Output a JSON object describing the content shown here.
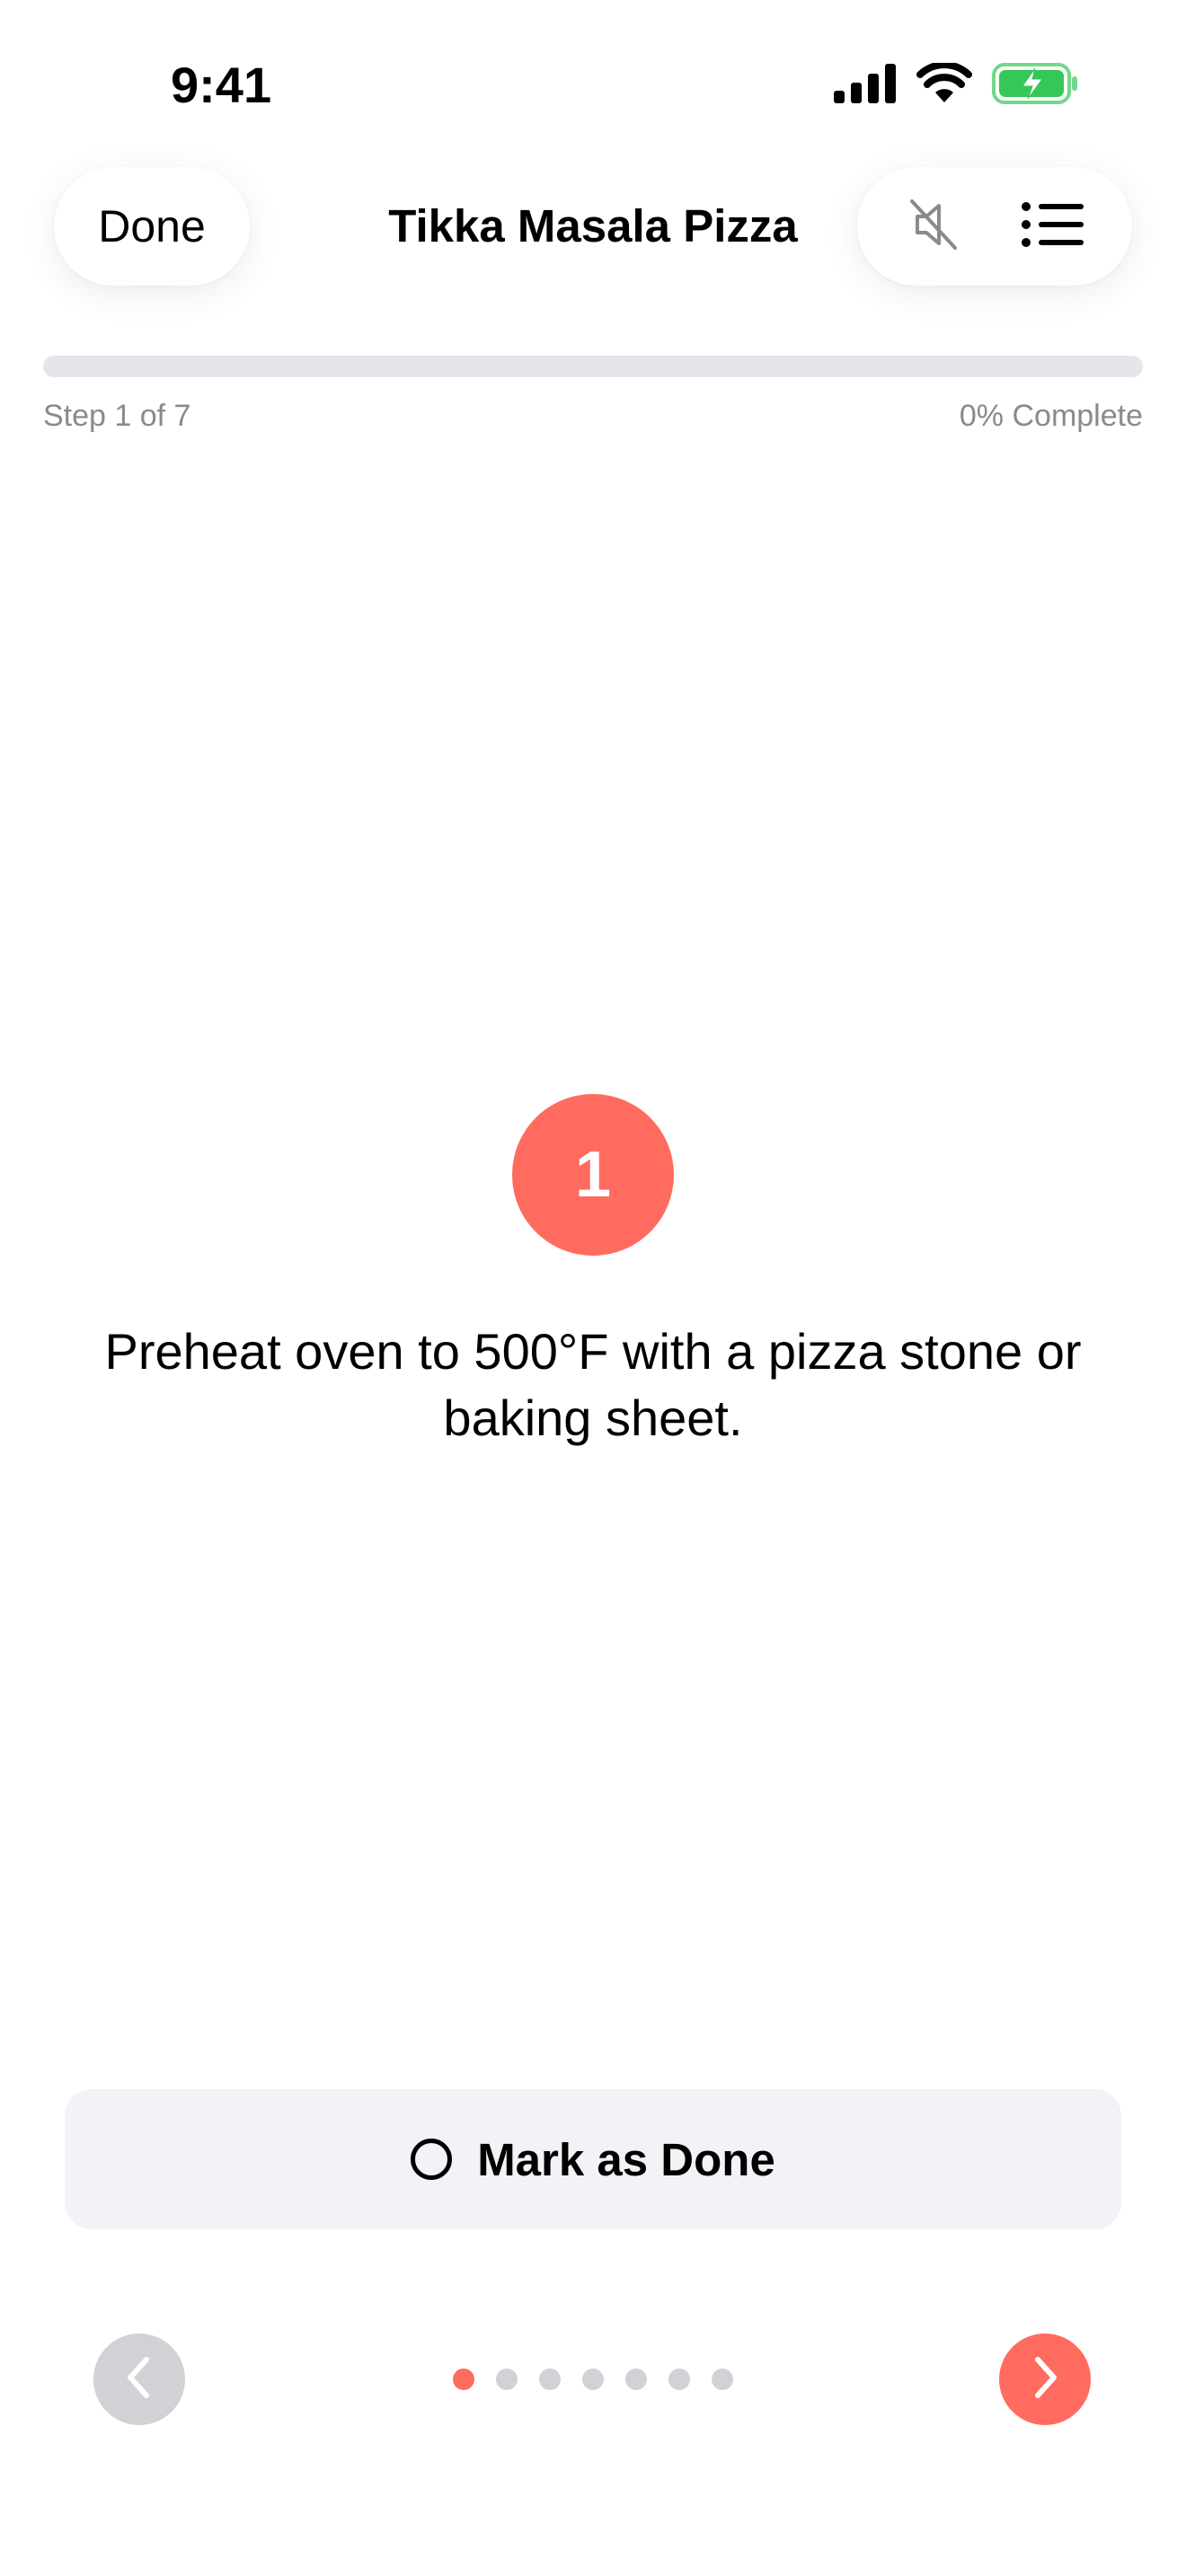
{
  "status_bar": {
    "time": "9:41",
    "icons": [
      "cellular-signal-icon",
      "wifi-icon",
      "battery-charging-icon"
    ],
    "battery_color": "#34c759"
  },
  "nav": {
    "done_label": "Done",
    "title": "Tikka Masala Pizza",
    "icons": [
      "speaker-muted-icon",
      "list-icon"
    ]
  },
  "progress": {
    "step_label": "Step 1 of 7",
    "percent_label": "0% Complete",
    "fraction": 0
  },
  "step": {
    "number": "1",
    "instruction": "Preheat oven to 500°F with a pizza stone or baking sheet."
  },
  "actions": {
    "mark_done_label": "Mark as Done",
    "mark_done_icon": "circle-outline-icon"
  },
  "pager": {
    "total": 7,
    "current": 1,
    "prev_icon": "chevron-left-icon",
    "next_icon": "chevron-right-icon"
  },
  "colors": {
    "accent": "#ff6b5e",
    "disabled": "#d1d1d6",
    "surface": "#f2f2f7",
    "secondary_text": "#8a8a8e"
  }
}
